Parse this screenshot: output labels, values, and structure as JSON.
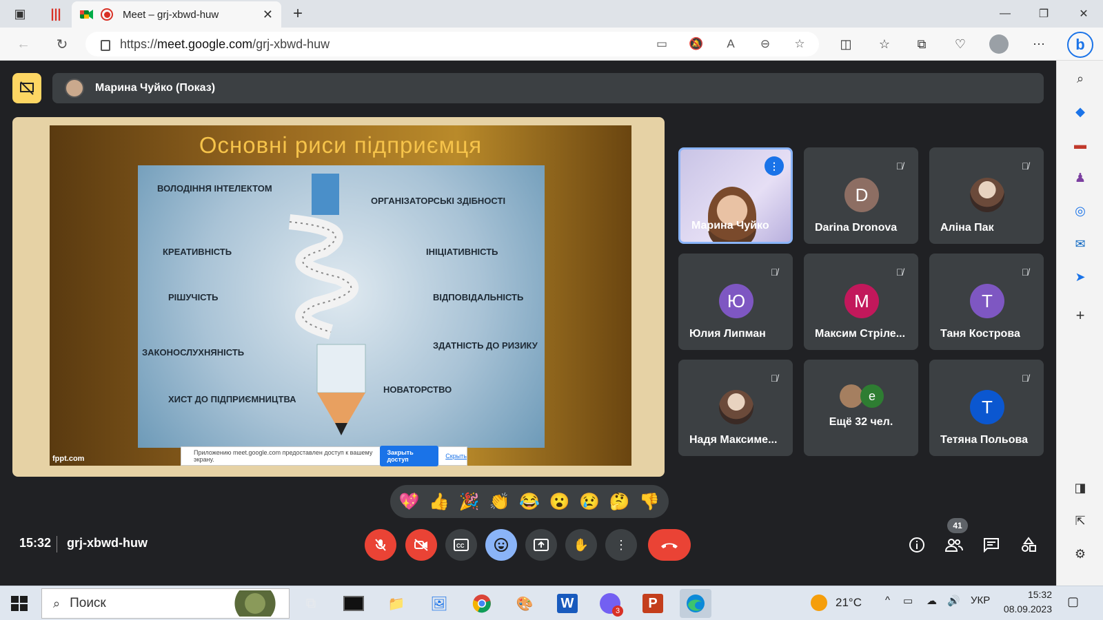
{
  "browser": {
    "tab_title": "Meet – grj-xbwd-huw",
    "new_tab": "+",
    "close_tab": "✕",
    "url_prefix": "https://",
    "url_host": "meet.google.com",
    "url_path": "/grj-xbwd-huw"
  },
  "meet": {
    "presenter_label": "Марина Чуйко (Показ)",
    "slide": {
      "title": "Основні риси підприємця",
      "labels": [
        "ВОЛОДІННЯ ІНТЕЛЕКТОМ",
        "ОРГАНІЗАТОРСЬКІ ЗДІБНОСТІ",
        "КРЕАТИВНІСТЬ",
        "ІНІЦІАТИВНІСТЬ",
        "РІШУЧІСТЬ",
        "ВІДПОВІДАЛЬНІСТЬ",
        "ЗАКОНОСЛУХНЯНІСТЬ",
        "ЗДАТНІСТЬ ДО РИЗИКУ",
        "ХИСТ ДО ПІДПРИЄМНИЦТВА",
        "НОВАТОРСТВО"
      ],
      "watermark": "fppt.com"
    },
    "share_notice": {
      "text": "Приложению meet.google.com предоставлен доступ к вашему экрану.",
      "stop_label": "Закрыть доступ",
      "hide_label": "Скрыть"
    },
    "participants": [
      {
        "name": "Марина Чуйко",
        "initial": "",
        "color": ""
      },
      {
        "name": "Darina Dronova",
        "initial": "D",
        "color": "#8d6e63"
      },
      {
        "name": "Аліна Пак",
        "initial": "",
        "color": ""
      },
      {
        "name": "Юлия Липман",
        "initial": "Ю",
        "color": "#7e57c2"
      },
      {
        "name": "Максим Стріле...",
        "initial": "M",
        "color": "#c2185b"
      },
      {
        "name": "Таня Кострова",
        "initial": "T",
        "color": "#7e57c2"
      },
      {
        "name": "Надя Максиме...",
        "initial": "",
        "color": ""
      },
      {
        "name": "Ещё 32 чел.",
        "initial": "e",
        "color": "#2e7d32"
      },
      {
        "name": "Тетяна Польова",
        "initial": "T",
        "color": "#0b57d0"
      }
    ],
    "reactions": [
      "💖",
      "👍",
      "🎉",
      "👏",
      "😂",
      "😮",
      "😢",
      "🤔",
      "👎"
    ],
    "clock": "15:32",
    "meeting_code": "grj-xbwd-huw",
    "people_count": "41"
  },
  "taskbar": {
    "search_placeholder": "Поиск",
    "weather": "21°C",
    "language": "УКР",
    "time": "15:32",
    "date": "08.09.2023",
    "viber_badge": "3"
  },
  "colors": {
    "meet_bg": "#202124",
    "tile_bg": "#3c4043",
    "danger": "#ea4335",
    "accent": "#8ab4f8",
    "present_stop": "#fdd663"
  }
}
